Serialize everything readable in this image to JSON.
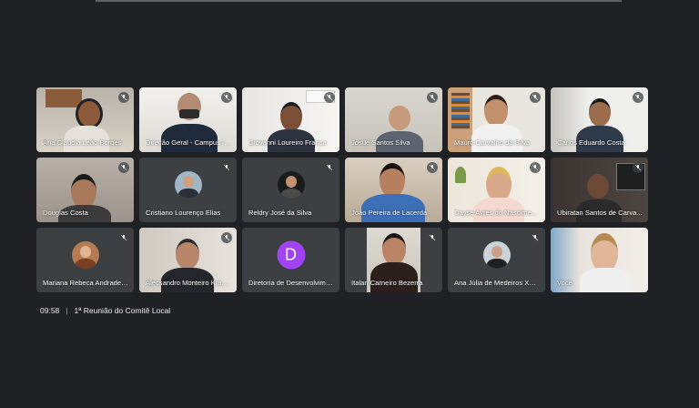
{
  "participants": [
    {
      "name": "Ana Claudia Leão Borges",
      "muted": true
    },
    {
      "name": "Direção Geral - Campus Itab...",
      "muted": true
    },
    {
      "name": "Giovanni Loureiro França",
      "muted": true
    },
    {
      "name": "Josué Santos Silva",
      "muted": true
    },
    {
      "name": "Mauro Carvalho da Silva",
      "muted": true
    },
    {
      "name": "Carlos Eduardo Costa",
      "muted": true
    },
    {
      "name": "Douglas Costa",
      "muted": true
    },
    {
      "name": "Cristiano Lourenço Elias",
      "muted": true
    },
    {
      "name": "Reldry José da Silva",
      "muted": true
    },
    {
      "name": "João Pereira de Lacerda",
      "muted": true
    },
    {
      "name": "Dayse Ayres do Nascime...",
      "muted": true
    },
    {
      "name": "Ubiratan Santos de Carva...",
      "muted": true
    },
    {
      "name": "Mariana Rebeca Andrade ...",
      "muted": true
    },
    {
      "name": "Alecsandro Monteiro Kra...",
      "muted": true
    },
    {
      "name": "Diretoria de Desenvolvime...",
      "muted": false,
      "avatar_letter": "D"
    },
    {
      "name": "Italan Carneiro Bezerra",
      "muted": true
    },
    {
      "name": "Ana Júlia de Medeiros Xav...",
      "muted": true
    },
    {
      "name": "Você",
      "muted": false
    }
  ],
  "meeting": {
    "time": "09:58",
    "separator": "|",
    "title": "1ª Reunião do Comitê Local"
  },
  "colors": {
    "background": "#202124",
    "tile": "#3c4043",
    "active_speaker": "#8ab4f8",
    "avatar_letter_bg": "#a142f4"
  }
}
